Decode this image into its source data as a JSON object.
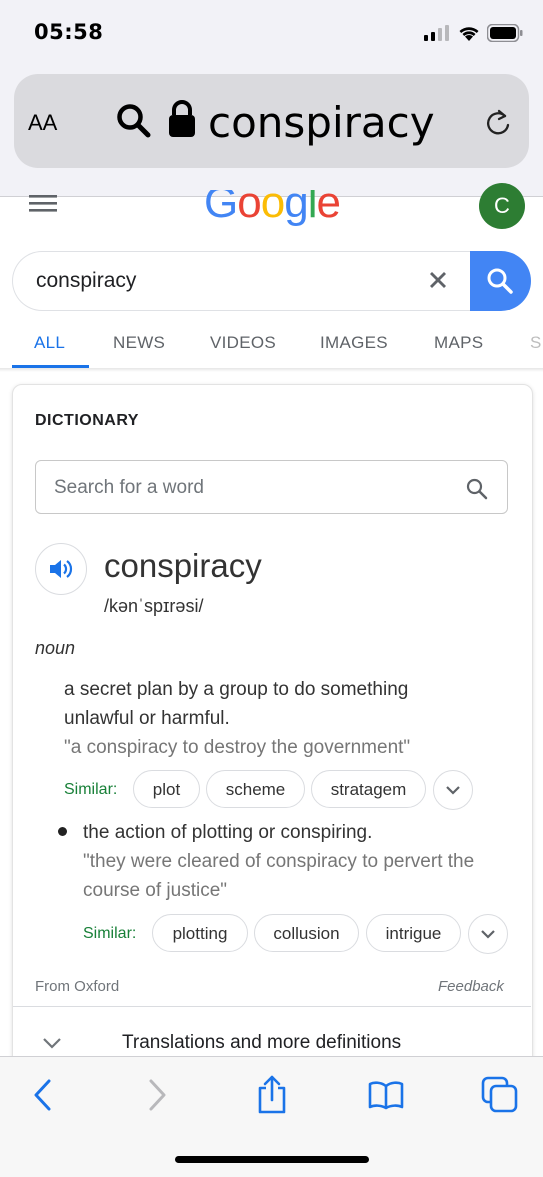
{
  "status_bar": {
    "time": "05:58"
  },
  "safari": {
    "aa_label": "AA",
    "address": "conspiracy"
  },
  "google": {
    "logo": "Google",
    "avatar_letter": "C",
    "search_value": "conspiracy",
    "tabs": [
      "ALL",
      "NEWS",
      "VIDEOS",
      "IMAGES",
      "MAPS",
      "S"
    ]
  },
  "dictionary": {
    "heading": "DICTIONARY",
    "search_placeholder": "Search for a word",
    "word": "conspiracy",
    "phonetic": "/kənˈspɪrəsi/",
    "part_of_speech": "noun",
    "senses": [
      {
        "definition_lines": [
          "a secret plan by a group to do something",
          "unlawful or harmful."
        ],
        "example": "\"a conspiracy to destroy the government\"",
        "similar_label": "Similar:",
        "similar": [
          "plot",
          "scheme",
          "stratagem"
        ]
      },
      {
        "definition_lines": [
          "the action of plotting or conspiring."
        ],
        "example_lines": [
          "\"they were cleared of conspiracy to pervert the",
          "course of justice\""
        ],
        "similar_label": "Similar:",
        "similar": [
          "plotting",
          "collusion",
          "intrigue"
        ]
      }
    ],
    "source": "From Oxford",
    "feedback": "Feedback",
    "more": "Translations and more definitions"
  },
  "colors": {
    "accent": "#1a73e8",
    "similar_green": "#188038",
    "avatar": "#2d7d33",
    "search_button": "#4285f4"
  }
}
